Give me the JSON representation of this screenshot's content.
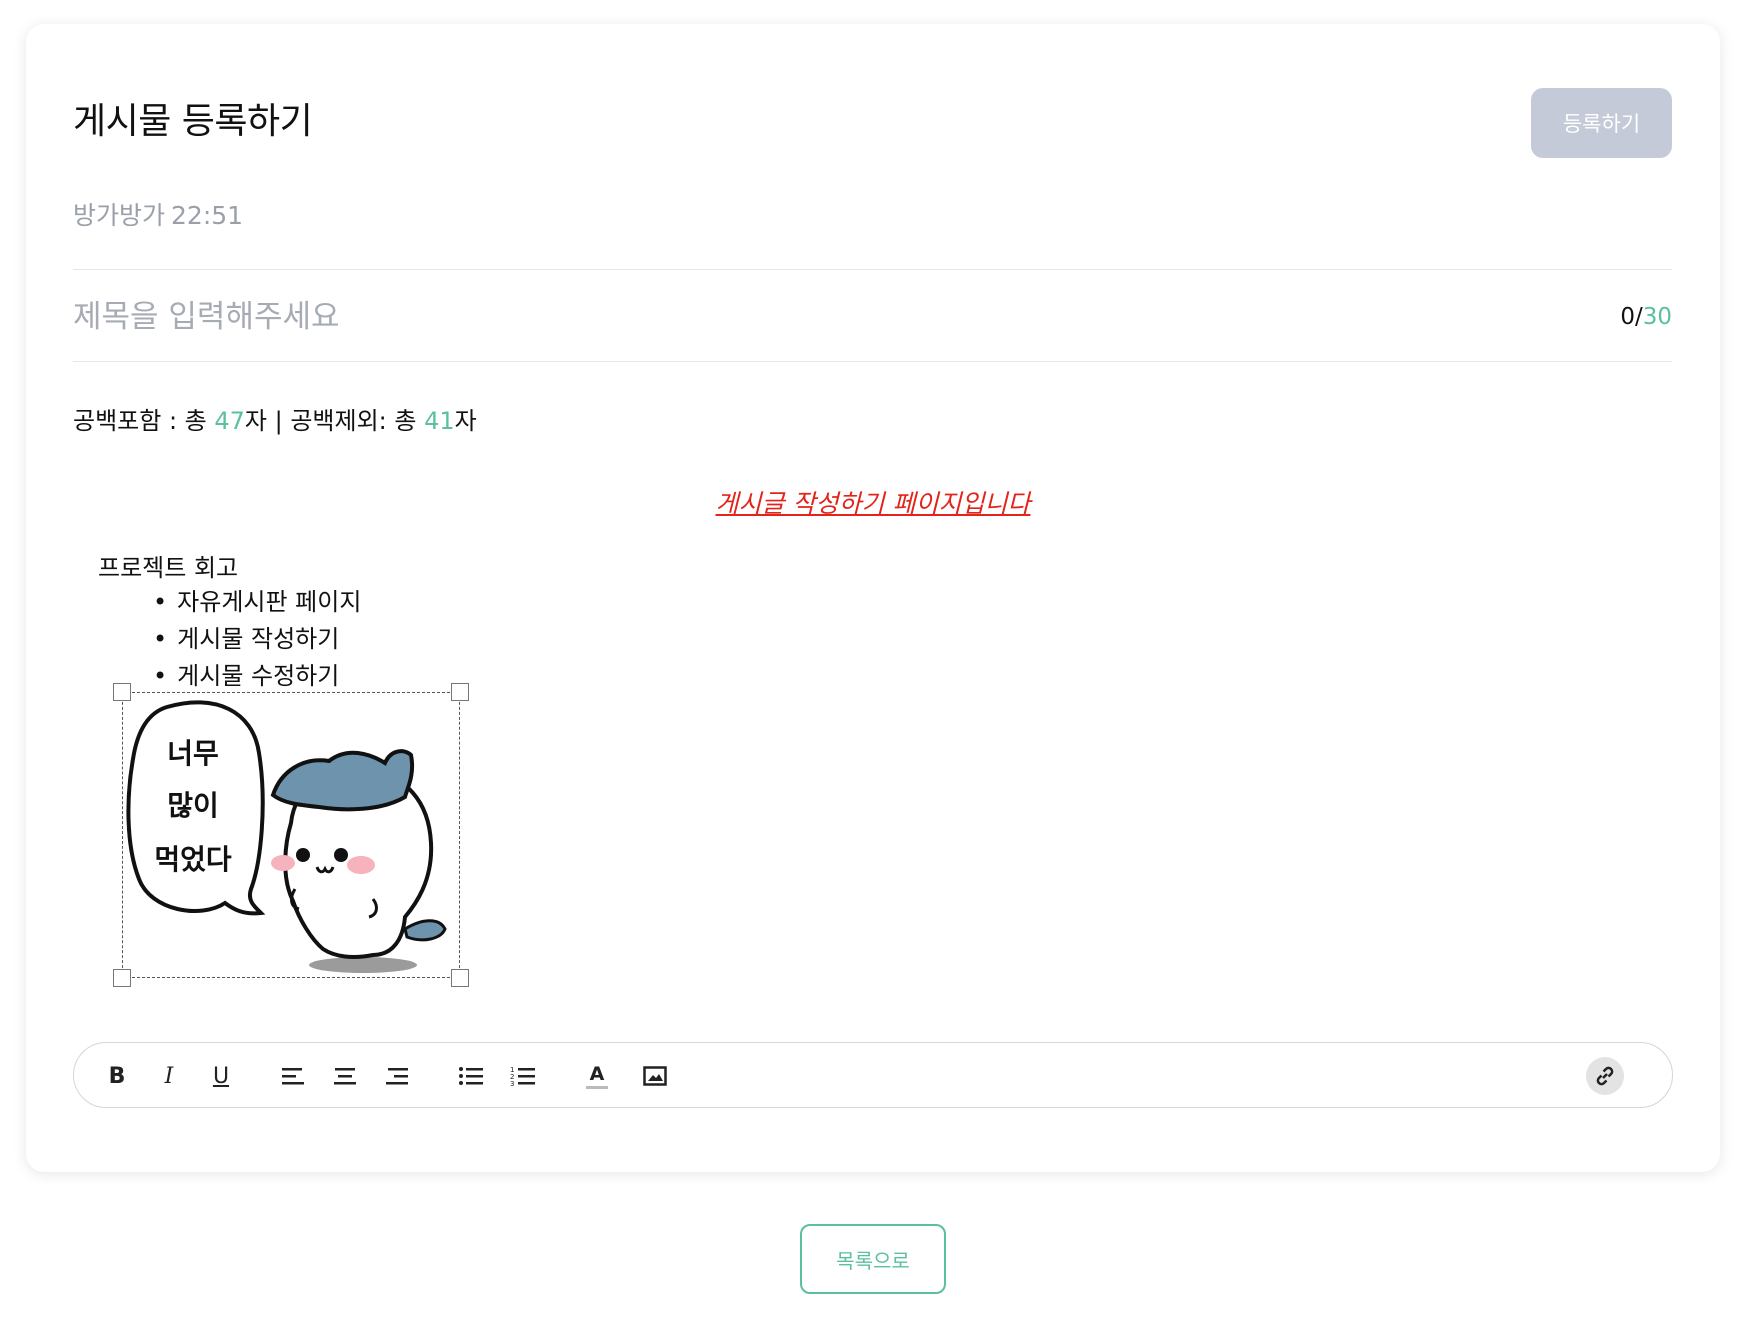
{
  "header": {
    "title": "게시물 등록하기",
    "submit_label": "등록하기"
  },
  "meta": {
    "author": "방가방가",
    "time": "22:51"
  },
  "title_field": {
    "placeholder": "제목을 입력해주세요",
    "count_current": "0/",
    "count_max": "30"
  },
  "char_count": {
    "with_space_prefix": "공백포함 : 총 ",
    "with_space_count": "47",
    "separator": "자 | 공백제외: 총 ",
    "without_space_count": "41",
    "suffix": "자"
  },
  "editor": {
    "intro_line": "게시글 작성하기 페이지입니다",
    "heading": "프로젝트 회고",
    "bullets": [
      "자유게시판 페이지",
      "게시물 작성하기",
      "게시물 수정하기"
    ],
    "sticker_text": [
      "너무",
      "많이",
      "먹었다"
    ]
  },
  "toolbar": {
    "buttons": [
      "bold",
      "italic",
      "underline",
      "align-left",
      "align-center",
      "align-right",
      "bullet-list",
      "ordered-list",
      "text-color",
      "image",
      "link"
    ],
    "bold_glyph": "B",
    "italic_glyph": "I",
    "underline_glyph": "U",
    "text_color_glyph": "A"
  },
  "footer": {
    "list_button_label": "목록으로"
  },
  "colors": {
    "accent": "#5cc09c",
    "disabled_button": "#c5cad8",
    "red_text": "#e3241b",
    "muted_text": "#9aa0aa"
  }
}
